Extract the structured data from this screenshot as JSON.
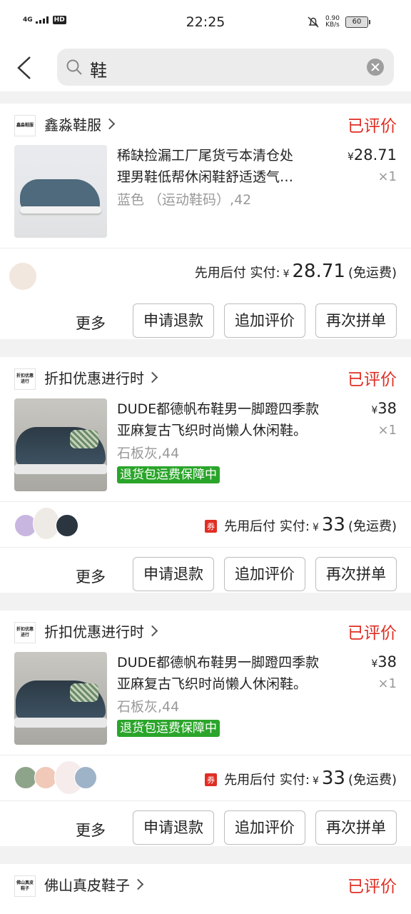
{
  "status_bar": {
    "network": "4G",
    "hd": "HD",
    "time": "22:25",
    "speed": "0.90",
    "speed_unit": "KB/s",
    "battery": "60"
  },
  "search": {
    "query": "鞋"
  },
  "orders": [
    {
      "shop_logo": "鑫淼鞋服",
      "shop_name": "鑫淼鞋服",
      "status": "已评价",
      "title_line1": "稀缺捡漏工厂尾货亏本清仓处",
      "title_line2": "理男鞋低帮休闲鞋舒适透气…",
      "price": "28.71",
      "qty": "×1",
      "variant": "蓝色 （运动鞋码）,42",
      "pay_prefix": "先用后付 实付:",
      "paid": "28.71",
      "shipping": "(免运费)"
    },
    {
      "shop_logo": "折扣优惠进行",
      "shop_name": "折扣优惠进行时",
      "status": "已评价",
      "title_line1": "DUDE都德帆布鞋男一脚蹬四季款",
      "title_line2": "亚麻复古飞织时尚懒人休闲鞋。",
      "price": "38",
      "qty": "×1",
      "variant": "石板灰,44",
      "guarantee": "退货包运费保障中",
      "coupon": "券",
      "pay_prefix": "先用后付 实付:",
      "paid": "33",
      "shipping": "(免运费)"
    },
    {
      "shop_logo": "折扣优惠进行",
      "shop_name": "折扣优惠进行时",
      "status": "已评价",
      "title_line1": "DUDE都德帆布鞋男一脚蹬四季款",
      "title_line2": "亚麻复古飞织时尚懒人休闲鞋。",
      "price": "38",
      "qty": "×1",
      "variant": "石板灰,44",
      "guarantee": "退货包运费保障中",
      "coupon": "券",
      "pay_prefix": "先用后付 实付:",
      "paid": "33",
      "shipping": "(免运费)"
    },
    {
      "shop_logo": "佛山真皮鞋子",
      "shop_name": "佛山真皮鞋子",
      "status": "已评价"
    }
  ],
  "actions": {
    "more": "更多",
    "refund": "申请退款",
    "add_review": "追加评价",
    "reorder": "再次拼单"
  },
  "currency": "¥",
  "colors": {
    "accent_red": "#e02e24",
    "guarantee_green": "#2aa52a"
  }
}
